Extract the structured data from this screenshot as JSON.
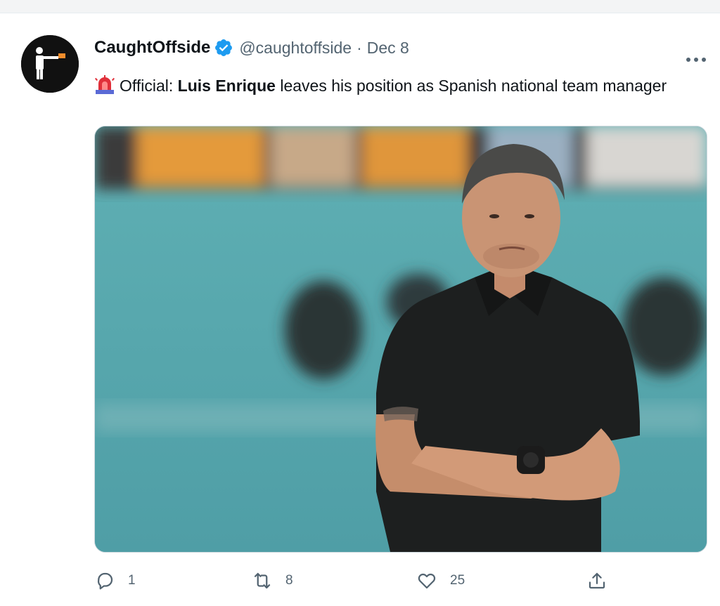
{
  "tweet": {
    "display_name": "CaughtOffside",
    "handle": "@caughtoffside",
    "separator": "·",
    "date": "Dec 8",
    "text": {
      "prefix": "Official: ",
      "bold": "Luis Enrique",
      "rest": " leaves his position as Spanish national team manager"
    },
    "icons": {
      "verified": "verified-badge-icon",
      "leading_emoji": "siren-icon",
      "more": "more-icon"
    },
    "media": {
      "description_icon": "photo-icon"
    },
    "actions": {
      "reply_count": "1",
      "retweet_count": "8",
      "like_count": "25"
    }
  },
  "colors": {
    "verified_blue": "#1d9bf0",
    "text_primary": "#0f1419",
    "text_secondary": "#536471",
    "avatar_background": "#111111"
  }
}
